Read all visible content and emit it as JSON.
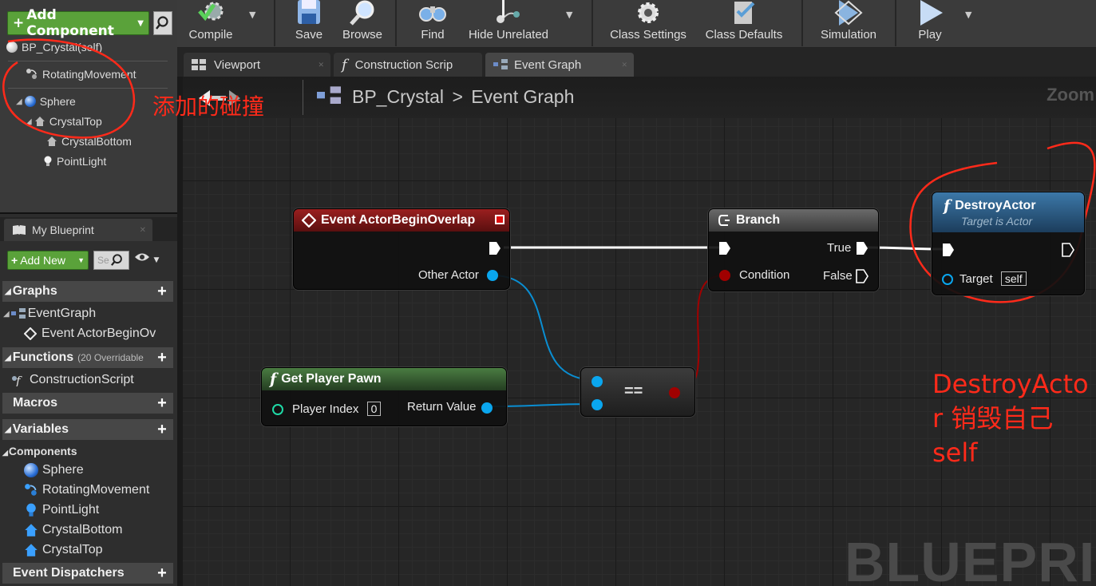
{
  "toolbar": {
    "compile": "Compile",
    "save": "Save",
    "browse": "Browse",
    "find": "Find",
    "hide_unrelated": "Hide Unrelated",
    "class_settings": "Class Settings",
    "class_defaults": "Class Defaults",
    "simulation": "Simulation",
    "play": "Play"
  },
  "components_panel": {
    "add_component": "Add Component",
    "root": "BP_Crystal(self)",
    "items": [
      "RotatingMovement",
      "Sphere",
      "CrystalTop",
      "CrystalBottom",
      "PointLight"
    ]
  },
  "doc_tabs": [
    "Viewport",
    "Construction Scrip",
    "Event Graph"
  ],
  "my_blueprint": {
    "tab": "My Blueprint",
    "add_new": "Add New",
    "search_placeholder": "Se",
    "graphs": "Graphs",
    "event_graph": "EventGraph",
    "event_item": "Event ActorBeginOv",
    "functions": "Functions",
    "functions_sub": "(20 Overridable",
    "construction_script": "ConstructionScript",
    "macros": "Macros",
    "variables": "Variables",
    "components": "Components",
    "component_items": [
      "Sphere",
      "RotatingMovement",
      "PointLight",
      "CrystalBottom",
      "CrystalTop"
    ],
    "event_dispatchers": "Event Dispatchers"
  },
  "graph": {
    "breadcrumb_bp": "BP_Crystal",
    "breadcrumb_sep": ">",
    "breadcrumb_graph": "Event Graph",
    "zoom": "Zoom",
    "watermark": "BLUEPRIN"
  },
  "nodes": {
    "event_overlap": {
      "title": "Event ActorBeginOverlap",
      "pin_other_actor": "Other Actor"
    },
    "branch": {
      "title": "Branch",
      "pin_condition": "Condition",
      "pin_true": "True",
      "pin_false": "False"
    },
    "destroy": {
      "title": "DestroyActor",
      "subtitle": "Target is Actor",
      "pin_target": "Target",
      "target_value": "self"
    },
    "get_pawn": {
      "title": "Get Player Pawn",
      "pin_index": "Player Index",
      "index_value": "0",
      "pin_return": "Return Value"
    },
    "equals": {
      "label": "=="
    }
  },
  "annotations": {
    "collision_note": "添加的碰撞",
    "destroy_note_1": "DestroyActo",
    "destroy_note_2": "r 销毁自己",
    "destroy_note_3": "self"
  },
  "colors": {
    "accent_green": "#5aa23a",
    "event_header": "#8b1a1a",
    "function_header": "#2c5f86",
    "pure_header": "#3d6a35",
    "annotation_red": "#ff2a1a",
    "object_pin": "#0aa6ee",
    "bool_pin": "#a00000"
  }
}
